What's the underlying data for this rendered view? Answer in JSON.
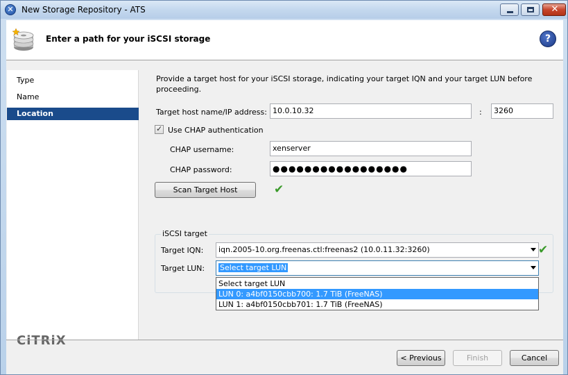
{
  "window": {
    "title": "New Storage Repository - ATS",
    "close_glyph": "✕",
    "app_glyph": "✕"
  },
  "header": {
    "title": "Enter a path for your iSCSI storage",
    "help_glyph": "?"
  },
  "nav": {
    "items": [
      {
        "label": "Type",
        "active": false
      },
      {
        "label": "Name",
        "active": false
      },
      {
        "label": "Location",
        "active": true
      }
    ],
    "brand": "CiTRiX"
  },
  "form": {
    "intro": "Provide a target host for your iSCSI storage, indicating your target IQN and your target LUN before proceeding.",
    "host_label": "Target host name/IP address:",
    "host_value": "10.0.10.32",
    "port_separator": ":",
    "port_value": "3260",
    "chap_checkbox_label": "Use CHAP authentication",
    "chap_checked": true,
    "chap_username_label": "CHAP username:",
    "chap_username_value": "xenserver",
    "chap_password_label": "CHAP password:",
    "chap_password_value": "●●●●●●●●●●●●●●●●●",
    "scan_button": "Scan Target Host",
    "check_glyph": "✔"
  },
  "iscsi": {
    "group_label": "iSCSI target",
    "iqn_label": "Target IQN:",
    "iqn_value": "iqn.2005-10.org.freenas.ctl:freenas2 (10.0.11.32:3260)",
    "lun_label": "Target LUN:",
    "lun_value": "Select target LUN",
    "lun_options": [
      {
        "label": "Select target LUN",
        "highlighted": false
      },
      {
        "label": "LUN 0: a4bf0150cbb700: 1.7 TiB (FreeNAS)",
        "highlighted": true
      },
      {
        "label": "LUN 1: a4bf0150cbb701: 1.7 TiB (FreeNAS)",
        "highlighted": false
      }
    ]
  },
  "footer": {
    "previous": "< Previous",
    "finish": "Finish",
    "cancel": "Cancel"
  },
  "colors": {
    "nav_active": "#1a4b8b",
    "highlight": "#3399ff",
    "success": "#3a9a2a"
  }
}
